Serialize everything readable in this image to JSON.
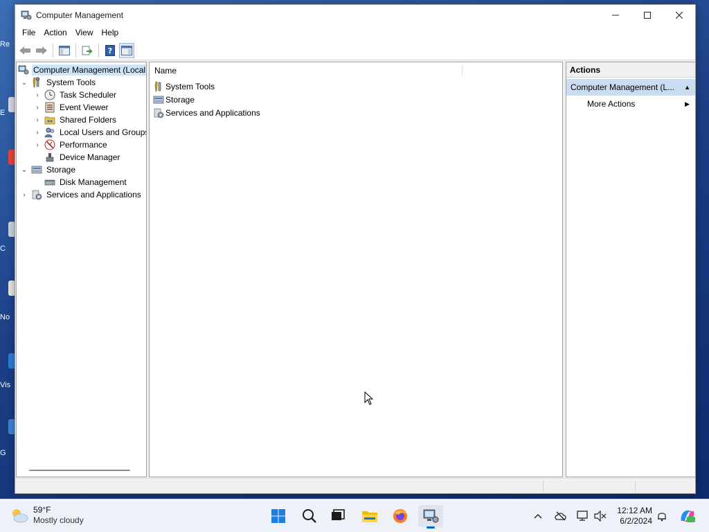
{
  "window": {
    "title": "Computer Management",
    "controls": [
      "minimize",
      "maximize",
      "close"
    ]
  },
  "menu": [
    "File",
    "Action",
    "View",
    "Help"
  ],
  "toolbar": [
    "back-arrow-icon",
    "forward-arrow-icon",
    "show-hide-console-tree-icon",
    "export-list-icon",
    "help-icon",
    "show-hide-action-pane-icon"
  ],
  "tree": {
    "root": "Computer Management (Local",
    "items": [
      {
        "label": "System Tools",
        "level": 1,
        "toggle": "expanded",
        "icon": "tools-icon"
      },
      {
        "label": "Task Scheduler",
        "level": 2,
        "toggle": "collapsed",
        "icon": "clock-icon"
      },
      {
        "label": "Event Viewer",
        "level": 2,
        "toggle": "collapsed",
        "icon": "event-viewer-icon"
      },
      {
        "label": "Shared Folders",
        "level": 2,
        "toggle": "collapsed",
        "icon": "shared-folder-icon"
      },
      {
        "label": "Local Users and Groups",
        "level": 2,
        "toggle": "collapsed",
        "icon": "users-icon"
      },
      {
        "label": "Performance",
        "level": 2,
        "toggle": "collapsed",
        "icon": "performance-icon"
      },
      {
        "label": "Device Manager",
        "level": 2,
        "toggle": "none",
        "icon": "device-manager-icon"
      },
      {
        "label": "Storage",
        "level": 1,
        "toggle": "expanded",
        "icon": "storage-icon"
      },
      {
        "label": "Disk Management",
        "level": 2,
        "toggle": "none",
        "icon": "disk-icon"
      },
      {
        "label": "Services and Applications",
        "level": 1,
        "toggle": "collapsed",
        "icon": "services-icon"
      }
    ]
  },
  "list": {
    "column_name": "Name",
    "rows": [
      {
        "label": "System Tools",
        "icon": "tools-icon"
      },
      {
        "label": "Storage",
        "icon": "storage-icon"
      },
      {
        "label": "Services and Applications",
        "icon": "services-icon"
      }
    ]
  },
  "actions": {
    "header": "Actions",
    "group": "Computer Management (L...",
    "items": [
      "More Actions"
    ]
  },
  "taskbar": {
    "weather_temp": "59°F",
    "weather_desc": "Mostly cloudy",
    "apps": [
      "start-icon",
      "search-icon",
      "task-view-icon",
      "file-explorer-icon",
      "firefox-icon",
      "computer-management-icon"
    ],
    "time": "12:12 AM",
    "date": "6/2/2024"
  },
  "desktop_fragments": [
    "Re",
    "E",
    "C",
    "No",
    "Vis",
    "G"
  ]
}
